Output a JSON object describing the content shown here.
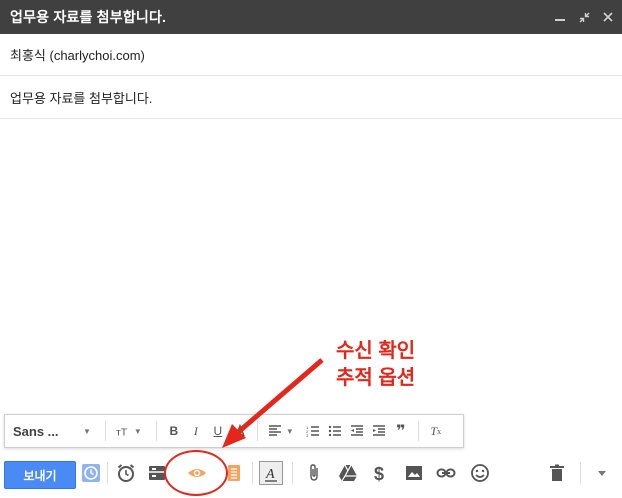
{
  "window": {
    "title": "업무용 자료를 첨부합니다.",
    "controls": [
      "minimize-icon",
      "expand-icon",
      "close-icon"
    ]
  },
  "compose": {
    "to": "최홍식 (charlychoi.com)",
    "subject_line": "업무용 자료를 첨부합니다."
  },
  "format_toolbar": {
    "font": "Sans ...",
    "buttons": [
      "text-size-icon",
      "bold-icon",
      "italic-icon",
      "underline-icon",
      "text-color-icon",
      "align-icon",
      "numbered-list-icon",
      "bulleted-list-icon",
      "indent-less-icon",
      "indent-more-icon",
      "quote-icon",
      "remove-formatting-icon"
    ]
  },
  "main_toolbar": {
    "send_label": "보내기",
    "buttons": [
      "schedule-icon",
      "snooze-clock-icon",
      "template-icon",
      "read-receipt-eye-icon",
      "tracking-list-icon",
      "formatting-toggle-icon",
      "attach-icon",
      "drive-icon",
      "money-icon",
      "photo-icon",
      "link-icon",
      "emoji-icon",
      "trash-icon",
      "more-options-icon"
    ]
  },
  "annotation": {
    "line1": "수신 확인",
    "line2": "추적 옵션"
  },
  "colors": {
    "titlebar": "#404040",
    "send_button": "#4a8af4",
    "annotation_red": "#e3271b",
    "eye_orange": "#f4a460"
  }
}
